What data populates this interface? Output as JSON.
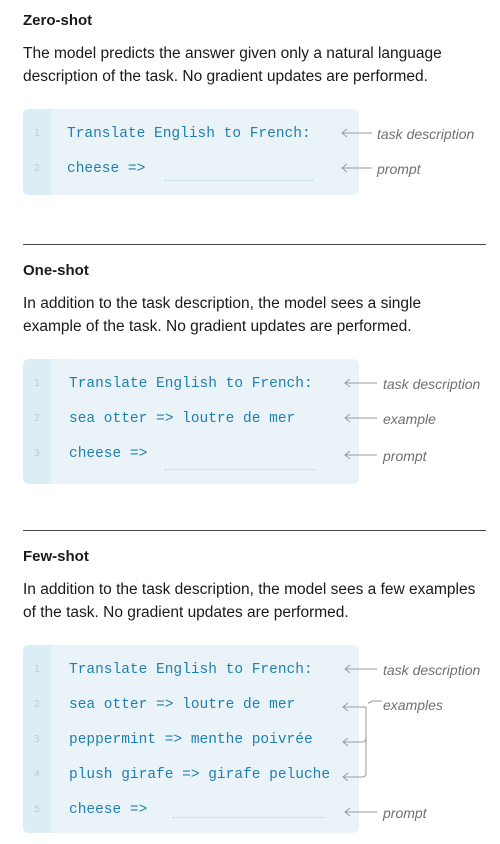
{
  "zero_shot": {
    "title": "Zero-shot",
    "description": "The model predicts the answer given only a natural language description of the task. No gradient updates are performed.",
    "lines": [
      {
        "num": "1",
        "code": "Translate English to French:",
        "annotation": "task description"
      },
      {
        "num": "2",
        "code": "cheese =>",
        "annotation": "prompt"
      }
    ]
  },
  "one_shot": {
    "title": "One-shot",
    "description": "In addition to the task description, the model sees a single example of the task. No gradient updates are performed.",
    "lines": [
      {
        "num": "1",
        "code": "Translate English to French:",
        "annotation": "task description"
      },
      {
        "num": "2",
        "code": "sea otter => loutre de mer",
        "annotation": "example"
      },
      {
        "num": "3",
        "code": "cheese =>",
        "annotation": "prompt"
      }
    ]
  },
  "few_shot": {
    "title": "Few-shot",
    "description": "In addition to the task description, the model sees a few examples of the task. No gradient updates are performed.",
    "lines": [
      {
        "num": "1",
        "code": "Translate English to French:",
        "annotation": "task description"
      },
      {
        "num": "2",
        "code": "sea otter => loutre de mer",
        "annotation": "examples"
      },
      {
        "num": "3",
        "code": "peppermint => menthe poivrée"
      },
      {
        "num": "4",
        "code": "plush girafe => girafe peluche"
      },
      {
        "num": "5",
        "code": "cheese =>",
        "annotation": "prompt"
      }
    ]
  }
}
